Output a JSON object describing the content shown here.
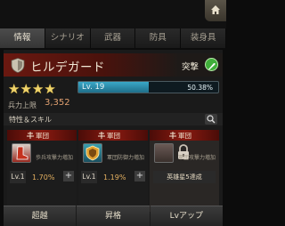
{
  "tabs": [
    {
      "label": "情報",
      "active": true
    },
    {
      "label": "シナリオ",
      "active": false
    },
    {
      "label": "武器",
      "active": false
    },
    {
      "label": "防具",
      "active": false
    },
    {
      "label": "装身具",
      "active": false
    }
  ],
  "hero": {
    "name": "ヒルデガード",
    "class_icon": "shield-icon",
    "role_label": "突撃",
    "role_icon": "attack-icon",
    "stars": "★★★★",
    "star_count": 4,
    "level": "Lv. 19",
    "xp_percent": "50.38%",
    "xp_fraction": 0.5038,
    "troop_label": "兵力上限",
    "troop_value": "3,352"
  },
  "skills": {
    "title": "特性＆スキル",
    "cards": [
      {
        "header": "軍団",
        "desc": "歩兵攻撃力増加",
        "level": "Lv.1",
        "percent": "1.70%",
        "plus": "+",
        "icon": "boot-icon"
      },
      {
        "header": "軍団",
        "desc": "軍団防御力増加",
        "level": "Lv.1",
        "percent": "1.19%",
        "plus": "+",
        "icon": "shield-skill-icon"
      },
      {
        "header": "軍団",
        "desc": "軍団攻撃力増加",
        "condition": "英雄星5達成",
        "icon": "lock-icon"
      }
    ]
  },
  "footer": {
    "btn1": "超越",
    "btn2": "昇格",
    "btn3": "Lvアップ"
  },
  "colors": {
    "accent_red": "#8a1a10",
    "xp_bar": "#3aa8c8",
    "star": "#f0d46a",
    "attack_green": "#3fae3a"
  }
}
